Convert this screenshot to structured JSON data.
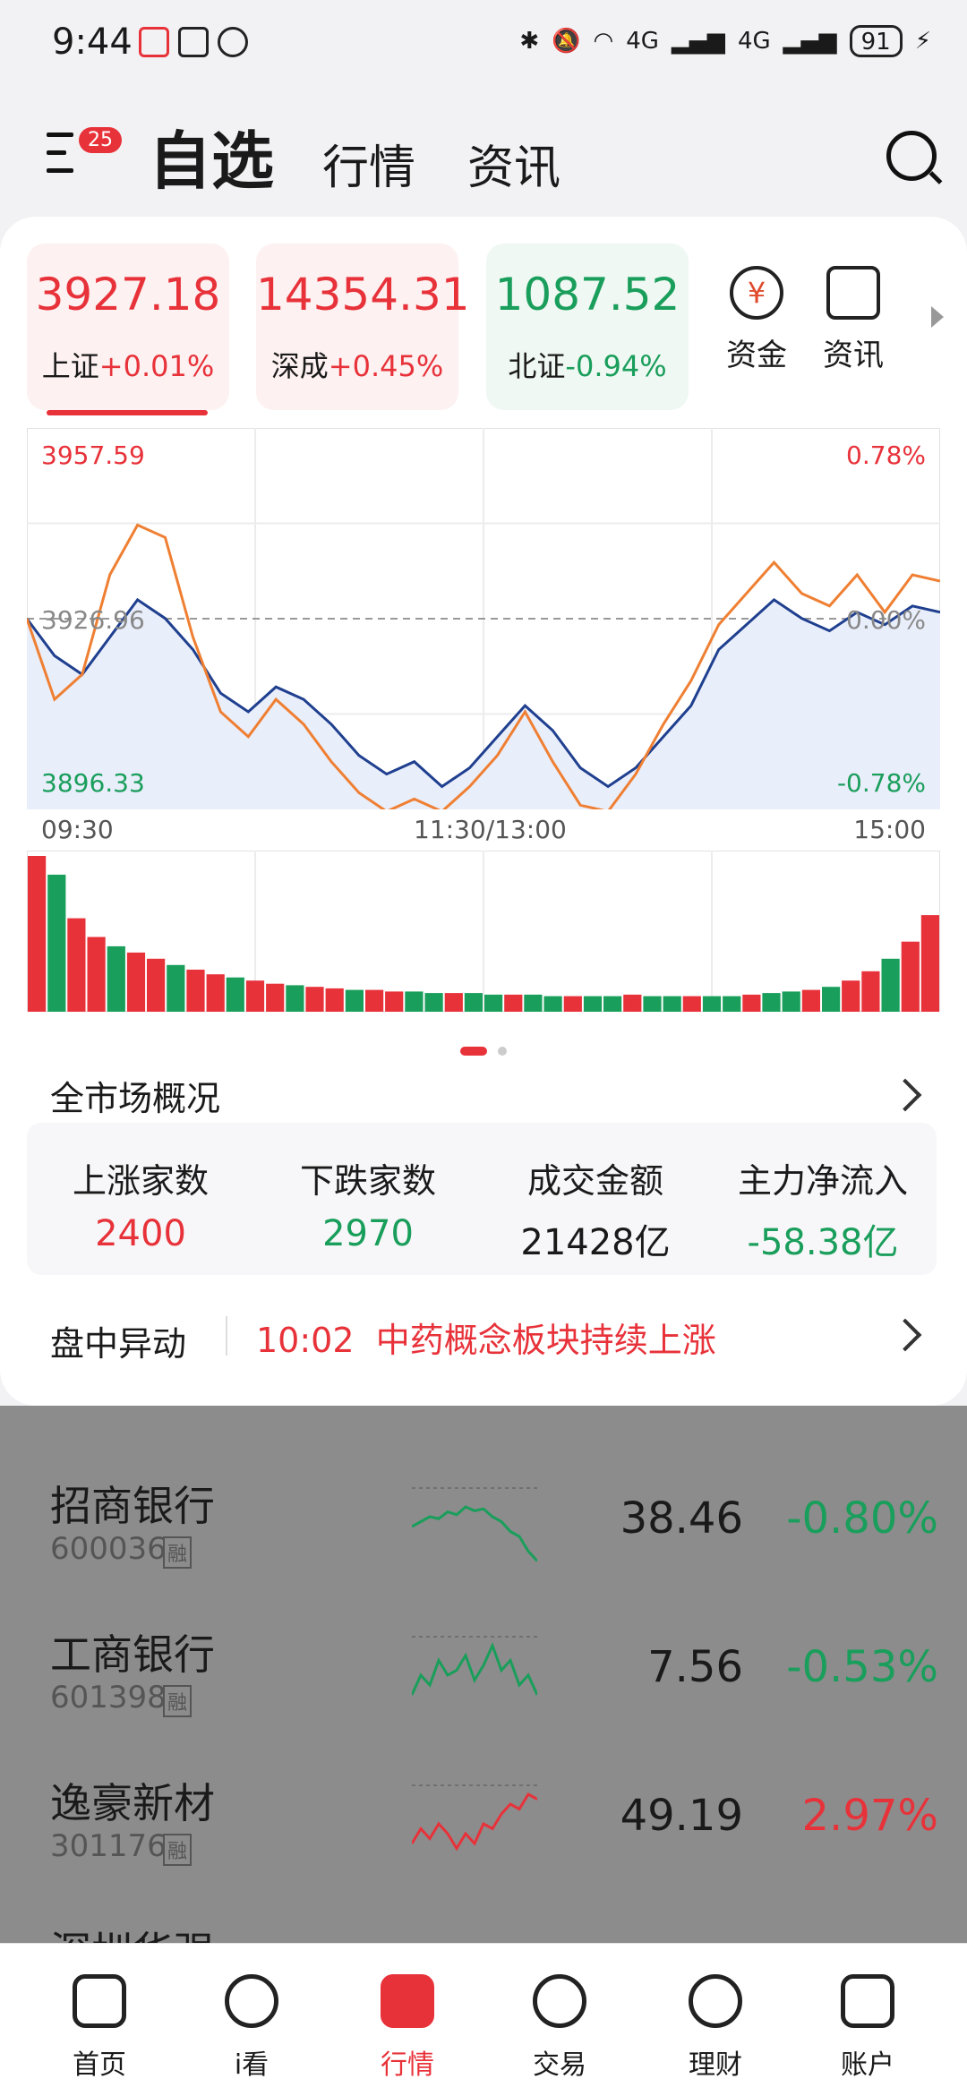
{
  "status": {
    "time": "9:44",
    "battery": "91",
    "net1": "4G",
    "net2": "4G"
  },
  "header": {
    "badge": "25",
    "tab_selected": "自选",
    "tab_market": "行情",
    "tab_news": "资讯"
  },
  "indices": [
    {
      "value": "3927.18",
      "name": "上证",
      "change": "+0.01%",
      "color": "#e8323a",
      "bg": "#fdf1f1"
    },
    {
      "value": "14354.31",
      "name": "深成",
      "change": "+0.45%",
      "color": "#e8323a",
      "bg": "#fdf1f1"
    },
    {
      "value": "1087.52",
      "name": "北证",
      "change": "-0.94%",
      "color": "#1a9e5b",
      "bg": "#eff8f3"
    }
  ],
  "quick": {
    "funds": "资金",
    "news": "资讯",
    "funds_glyph": "¥"
  },
  "chart": {
    "high": "3957.59",
    "mid": "3926.96",
    "low": "3896.33",
    "high_pct": "0.78%",
    "mid_pct": "0.00%",
    "low_pct": "-0.78%",
    "t_open": "09:30",
    "t_mid": "11:30/13:00",
    "t_close": "15:00"
  },
  "chart_data": {
    "type": "line",
    "ylim": [
      3896.33,
      3957.59
    ],
    "series": [
      {
        "values": [
          3926.96,
          3921,
          3918,
          3924,
          3930,
          3927,
          3922,
          3915,
          3912,
          3916,
          3914,
          3910,
          3905,
          3902,
          3904,
          3900,
          3903,
          3908,
          3913,
          3909,
          3903,
          3900,
          3903,
          3908,
          3913,
          3922,
          3926,
          3930,
          3927,
          3925,
          3928,
          3926,
          3929,
          3928
        ]
      },
      {
        "values": [
          3926.96,
          3914,
          3918,
          3934,
          3942,
          3940,
          3924,
          3912,
          3908,
          3914,
          3910,
          3904,
          3899,
          3896,
          3898,
          3896,
          3900,
          3905,
          3912,
          3904,
          3897,
          3896,
          3902,
          3910,
          3917,
          3926,
          3931,
          3936,
          3931,
          3929,
          3934,
          3928,
          3934,
          3933
        ]
      }
    ],
    "volume": [
      1.0,
      0.88,
      0.6,
      0.48,
      0.42,
      0.38,
      0.34,
      0.3,
      0.27,
      0.24,
      0.22,
      0.2,
      0.18,
      0.17,
      0.16,
      0.15,
      0.14,
      0.14,
      0.13,
      0.13,
      0.12,
      0.12,
      0.12,
      0.11,
      0.11,
      0.11,
      0.1,
      0.1,
      0.1,
      0.1,
      0.11,
      0.1,
      0.1,
      0.1,
      0.1,
      0.1,
      0.11,
      0.12,
      0.13,
      0.14,
      0.16,
      0.2,
      0.26,
      0.34,
      0.45,
      0.62
    ]
  },
  "overview": {
    "title": "全市场概况",
    "up_label": "上涨家数",
    "up_value": "2400",
    "down_label": "下跌家数",
    "down_value": "2970",
    "amount_label": "成交金额",
    "amount_value": "21428亿",
    "flow_label": "主力净流入",
    "flow_value": "-58.38亿"
  },
  "movement": {
    "label": "盘中异动",
    "time": "10:02",
    "text": "中药概念板块持续上涨"
  },
  "stocks": [
    {
      "name": "招商银行",
      "code": "600036",
      "tag": "融",
      "price": "38.46",
      "change": "-0.80%",
      "color": "#1a9e5b"
    },
    {
      "name": "工商银行",
      "code": "601398",
      "tag": "融",
      "price": "7.56",
      "change": "-0.53%",
      "color": "#1a9e5b"
    },
    {
      "name": "逸豪新材",
      "code": "301176",
      "tag": "融",
      "price": "49.19",
      "change": "2.97%",
      "color": "#e8323a"
    },
    {
      "name": "深圳华强",
      "code": "",
      "tag": "",
      "price": "",
      "change": "",
      "color": "#e8323a"
    }
  ],
  "tabbar": {
    "home": "首页",
    "watch": "i看",
    "market": "行情",
    "trade": "交易",
    "wealth": "理财",
    "account": "账户"
  }
}
